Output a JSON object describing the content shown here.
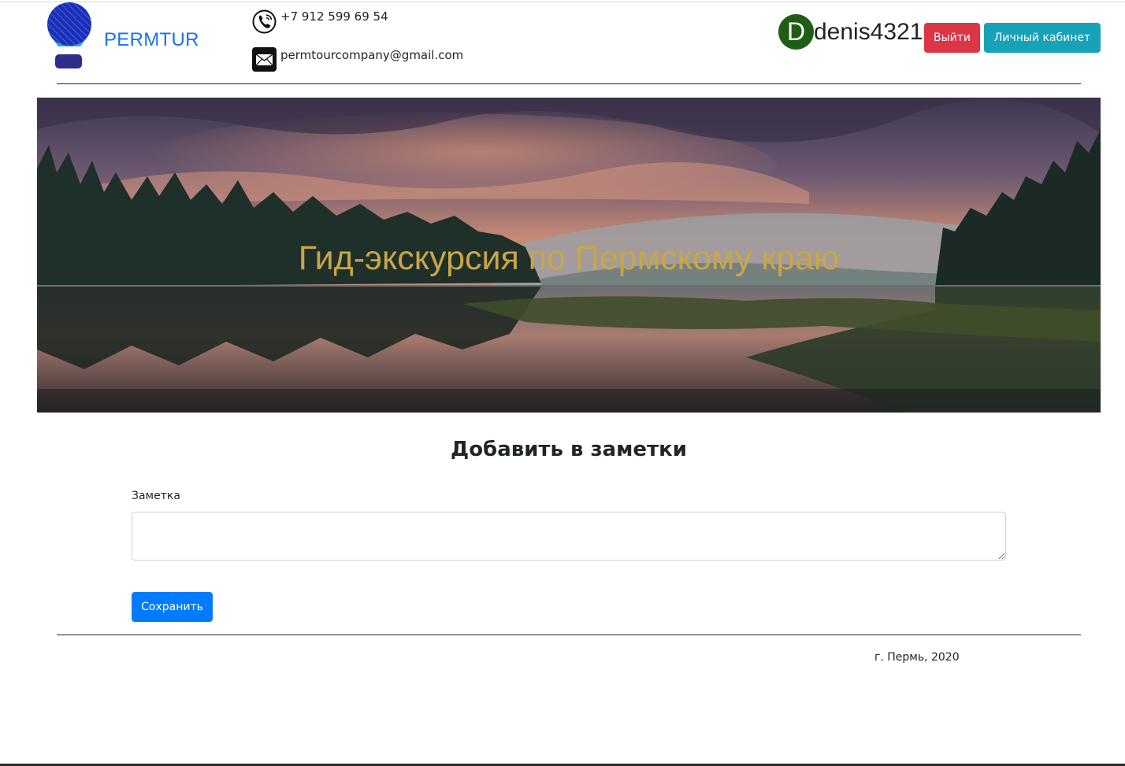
{
  "header": {
    "brand": "PERMTUR",
    "phone": "+7 912 599 69 54",
    "email": "permtourcompany@gmail.com",
    "avatar_letter": "D",
    "username": "denis4321",
    "logout_label": "Выйти",
    "cabinet_label": "Личный кабинет",
    "icons": {
      "logo": "balloon-logo-icon",
      "phone": "phone-icon",
      "email": "mail-icon"
    }
  },
  "hero": {
    "title": "Гид-экскурсия по Пермскому краю"
  },
  "form": {
    "title": "Добавить в заметки",
    "note_label": "Заметка",
    "note_value": "",
    "save_label": "Сохранить"
  },
  "footer": {
    "text": "г. Пермь, 2020"
  },
  "colors": {
    "brand": "#1a73e8",
    "avatar": "#1f5c14",
    "logout": "#dc3545",
    "cabinet": "#17a2b8",
    "save": "#007bff",
    "hero_title": "#c9a646"
  }
}
